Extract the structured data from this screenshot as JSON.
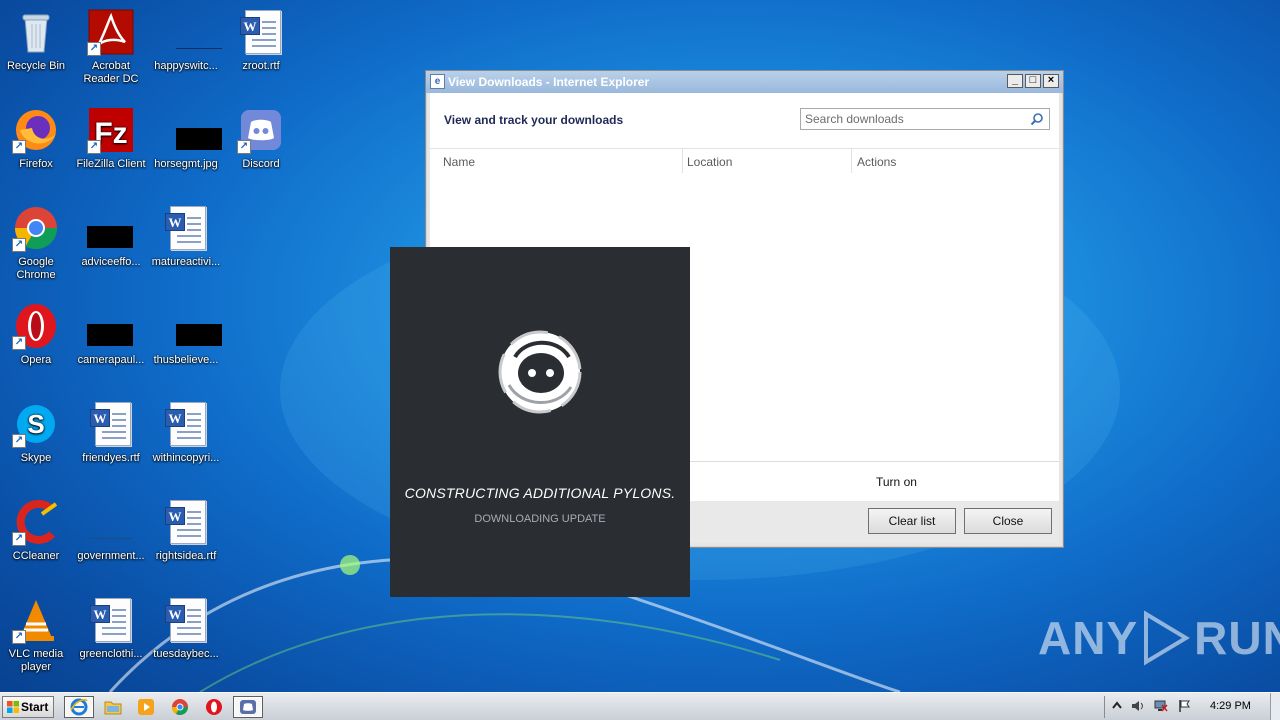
{
  "desktop": {
    "icons": [
      {
        "label": "Recycle Bin",
        "icon": "recycle-bin-icon"
      },
      {
        "label": "Acrobat Reader DC",
        "icon": "acrobat-icon"
      },
      {
        "label": "happyswitc...",
        "icon": "file-icon"
      },
      {
        "label": "zroot.rtf",
        "icon": "word-doc-icon"
      },
      {
        "label": "Firefox",
        "icon": "firefox-icon"
      },
      {
        "label": "FileZilla Client",
        "icon": "filezilla-icon"
      },
      {
        "label": "horsegmt.jpg",
        "icon": "image-file-icon"
      },
      {
        "label": "Discord",
        "icon": "discord-icon"
      },
      {
        "label": "Google Chrome",
        "icon": "chrome-icon"
      },
      {
        "label": "adviceeffo...",
        "icon": "file-icon"
      },
      {
        "label": "matureactivi...",
        "icon": "word-doc-icon"
      },
      {
        "label": "Opera",
        "icon": "opera-icon"
      },
      {
        "label": "camerapaul...",
        "icon": "file-icon"
      },
      {
        "label": "thusbelieve...",
        "icon": "file-icon"
      },
      {
        "label": "Skype",
        "icon": "skype-icon"
      },
      {
        "label": "friendyes.rtf",
        "icon": "word-doc-icon"
      },
      {
        "label": "withincopyri...",
        "icon": "word-doc-icon"
      },
      {
        "label": "CCleaner",
        "icon": "ccleaner-icon"
      },
      {
        "label": "government...",
        "icon": "file-icon"
      },
      {
        "label": "rightsidea.rtf",
        "icon": "word-doc-icon"
      },
      {
        "label": "VLC media player",
        "icon": "vlc-icon"
      },
      {
        "label": "greenclothi...",
        "icon": "word-doc-icon"
      },
      {
        "label": "tuesdaybec...",
        "icon": "word-doc-icon"
      }
    ]
  },
  "ie_window": {
    "title": "View Downloads - Internet Explorer",
    "heading": "View and track your downloads",
    "search_placeholder": "Search downloads",
    "columns": {
      "name": "Name",
      "location": "Location",
      "actions": "Actions"
    },
    "turn_on_label": "Turn on",
    "clear_list_label": "Clear list",
    "close_label": "Close"
  },
  "splash": {
    "title": "CONSTRUCTING ADDITIONAL PYLONS.",
    "subtitle": "DOWNLOADING UPDATE"
  },
  "watermark": {
    "left": "ANY",
    "right": "RUN"
  },
  "taskbar": {
    "start_label": "Start",
    "clock": "4:29 PM",
    "items": [
      "internet-explorer-icon",
      "file-explorer-icon",
      "media-player-icon",
      "chrome-icon",
      "opera-icon",
      "discord-icon"
    ]
  }
}
